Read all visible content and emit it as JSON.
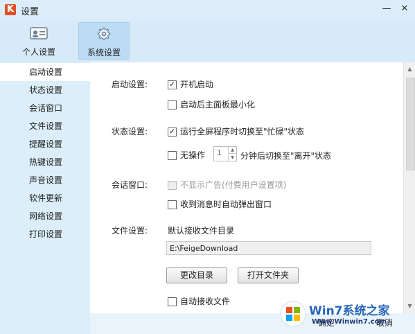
{
  "window": {
    "title": "设置",
    "minimize_icon": "minimize-icon",
    "close_icon": "close-icon"
  },
  "tabs": [
    {
      "label": "个人设置",
      "icon": "id-card-icon",
      "active": false
    },
    {
      "label": "系统设置",
      "icon": "gear-icon",
      "active": true
    }
  ],
  "sidebar": {
    "items": [
      {
        "label": "启动设置",
        "active": true
      },
      {
        "label": "状态设置"
      },
      {
        "label": "会话窗口"
      },
      {
        "label": "文件设置"
      },
      {
        "label": "提醒设置"
      },
      {
        "label": "热键设置"
      },
      {
        "label": "声音设置"
      },
      {
        "label": "软件更新"
      },
      {
        "label": "网络设置"
      },
      {
        "label": "打印设置"
      }
    ]
  },
  "content": {
    "startup": {
      "section_label": "启动设置:",
      "auto_start": {
        "label": "开机启动",
        "checked": true
      },
      "minimize_main": {
        "label": "启动后主面板最小化",
        "checked": false
      }
    },
    "status": {
      "section_label": "状态设置:",
      "fullscreen_busy": {
        "label": "运行全屏程序时切换至\"忙碌\"状态",
        "checked": true
      },
      "idle": {
        "label_before": "无操作",
        "value": "1",
        "label_after": "分钟后切换至\"离开\"状态",
        "checked": false
      }
    },
    "session": {
      "section_label": "会话窗口:",
      "no_ads": {
        "label": "不显示广告(付费用户设置项)",
        "checked": false,
        "disabled": true
      },
      "popup_on_message": {
        "label": "收到消息时自动弹出窗口",
        "checked": false
      }
    },
    "file": {
      "section_label": "文件设置:",
      "default_dir_label": "默认接收文件目录",
      "default_dir_value": "E:\\FeigeDownload",
      "change_dir_button": "更改目录",
      "open_folder_button": "打开文件夹",
      "auto_receive": {
        "label": "自动接收文件",
        "checked": false
      }
    }
  },
  "footer": {
    "ok_label": "确定",
    "cancel_label": "取消"
  },
  "watermark": {
    "brand": "Win7系统之家",
    "url": "Www.Winwin7.com"
  }
}
